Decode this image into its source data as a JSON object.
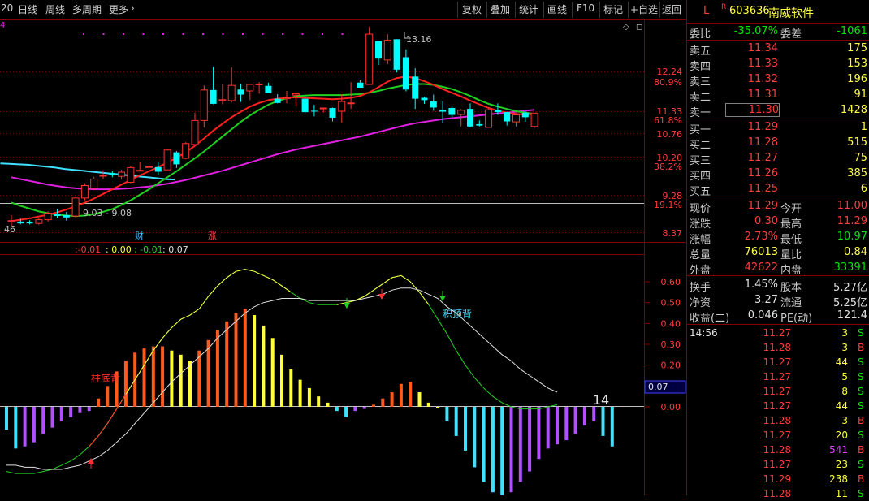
{
  "toolbar": {
    "period_num": "20",
    "daily": "日线",
    "weekly": "周线",
    "multi": "多周期",
    "more": "更多",
    "more_arrow": "›",
    "right_buttons": [
      "复权",
      "叠加",
      "统计",
      "画线",
      "F10",
      "标记",
      "+自选",
      "返回"
    ]
  },
  "stock": {
    "flag": "L",
    "flag2": "R",
    "code": "603636",
    "name": "南威软件"
  },
  "quote": {
    "weibi_label": "委比",
    "weibi": "-35.07%",
    "weicha_label": "委差",
    "weicha": "-1061",
    "sells": [
      {
        "label": "卖五",
        "price": "11.34",
        "vol": "175"
      },
      {
        "label": "卖四",
        "price": "11.33",
        "vol": "153"
      },
      {
        "label": "卖三",
        "price": "11.32",
        "vol": "196"
      },
      {
        "label": "卖二",
        "price": "11.31",
        "vol": "91"
      },
      {
        "label": "卖一",
        "price": "11.30",
        "vol": "1428"
      }
    ],
    "buys": [
      {
        "label": "买一",
        "price": "11.29",
        "vol": "1"
      },
      {
        "label": "买二",
        "price": "11.28",
        "vol": "515"
      },
      {
        "label": "买三",
        "price": "11.27",
        "vol": "75"
      },
      {
        "label": "买四",
        "price": "11.26",
        "vol": "385"
      },
      {
        "label": "买五",
        "price": "11.25",
        "vol": "6"
      }
    ],
    "stats": [
      {
        "l1": "现价",
        "v1": "11.29",
        "c1": "red",
        "l2": "今开",
        "v2": "11.00",
        "c2": "red"
      },
      {
        "l1": "涨跌",
        "v1": "0.30",
        "c1": "red",
        "l2": "最高",
        "v2": "11.29",
        "c2": "red"
      },
      {
        "l1": "涨幅",
        "v1": "2.73%",
        "c1": "red",
        "l2": "最低",
        "v2": "10.97",
        "c2": "green"
      },
      {
        "l1": "总量",
        "v1": "76013",
        "c1": "yellow",
        "l2": "量比",
        "v2": "0.84",
        "c2": "yellow"
      },
      {
        "l1": "外盘",
        "v1": "42622",
        "c1": "red",
        "l2": "内盘",
        "v2": "33391",
        "c2": "green"
      }
    ],
    "stats2": [
      {
        "l1": "换手",
        "v1": "1.45%",
        "l2": "股本",
        "v2": "5.27亿"
      },
      {
        "l1": "净资",
        "v1": "3.27",
        "l2": "流通",
        "v2": "5.25亿"
      },
      {
        "l1": "收益(二)",
        "v1": "0.046",
        "l2": "PE(动)",
        "v2": "121.4"
      }
    ]
  },
  "ticks": [
    {
      "time": "14:56",
      "price": "11.27",
      "vol": "3",
      "side": "S"
    },
    {
      "time": "",
      "price": "11.28",
      "vol": "3",
      "side": "B"
    },
    {
      "time": "",
      "price": "11.27",
      "vol": "44",
      "side": "S"
    },
    {
      "time": "",
      "price": "11.27",
      "vol": "5",
      "side": "S"
    },
    {
      "time": "",
      "price": "11.27",
      "vol": "8",
      "side": "S"
    },
    {
      "time": "",
      "price": "11.27",
      "vol": "44",
      "side": "S"
    },
    {
      "time": "",
      "price": "11.28",
      "vol": "3",
      "side": "B"
    },
    {
      "time": "",
      "price": "11.27",
      "vol": "20",
      "side": "S"
    },
    {
      "time": "",
      "price": "11.28",
      "vol": "541",
      "side": "B"
    },
    {
      "time": "",
      "price": "11.27",
      "vol": "23",
      "side": "S"
    },
    {
      "time": "",
      "price": "11.29",
      "vol": "238",
      "side": "B"
    },
    {
      "time": "",
      "price": "11.28",
      "vol": "11",
      "side": "S"
    }
  ],
  "colors": {
    "up": "#ff3232",
    "down": "#00ffff",
    "ma_red": "#ff2020",
    "ma_green": "#20d020",
    "ma_purple": "#e020e0",
    "ma_cyan": "#40e0ff",
    "grid": "#800000"
  },
  "chart_data": [
    {
      "type": "candlestick",
      "price_ticks": [
        "12.24",
        "11.33",
        "10.76",
        "10.20",
        "9.28",
        "8.37"
      ],
      "pct_ticks": [
        "80.9%",
        "61.8%",
        "38.2%",
        "19.1%"
      ],
      "high_label": "13.16",
      "low_label": "9.03 - 9.08",
      "left_label": "46",
      "top_left_label": "4",
      "markers": [
        "财",
        "涨"
      ],
      "candles": [
        {
          "o": 8.94,
          "h": 9.08,
          "l": 8.85,
          "c": 8.96
        },
        {
          "o": 8.94,
          "h": 9.0,
          "l": 8.88,
          "c": 8.9
        },
        {
          "o": 8.93,
          "h": 8.97,
          "l": 8.88,
          "c": 8.9
        },
        {
          "o": 8.9,
          "h": 9.01,
          "l": 8.87,
          "c": 8.98
        },
        {
          "o": 8.98,
          "h": 9.16,
          "l": 8.94,
          "c": 9.12
        },
        {
          "o": 9.11,
          "h": 9.21,
          "l": 9.02,
          "c": 9.06
        },
        {
          "o": 9.08,
          "h": 9.15,
          "l": 8.96,
          "c": 9.03
        },
        {
          "o": 9.06,
          "h": 9.48,
          "l": 9.03,
          "c": 9.45
        },
        {
          "o": 9.45,
          "h": 9.77,
          "l": 9.4,
          "c": 9.72
        },
        {
          "o": 9.66,
          "h": 9.91,
          "l": 9.62,
          "c": 9.86
        },
        {
          "o": 9.94,
          "h": 10.05,
          "l": 9.86,
          "c": 9.94
        },
        {
          "o": 9.99,
          "h": 10.03,
          "l": 9.9,
          "c": 9.95
        },
        {
          "o": 9.92,
          "h": 10.06,
          "l": 9.85,
          "c": 10.01
        },
        {
          "o": 9.79,
          "h": 10.14,
          "l": 9.77,
          "c": 10.11
        },
        {
          "o": 10.05,
          "h": 10.22,
          "l": 10.03,
          "c": 10.05
        },
        {
          "o": 10.13,
          "h": 10.21,
          "l": 10.06,
          "c": 10.13
        },
        {
          "o": 10.12,
          "h": 10.23,
          "l": 9.95,
          "c": 10.02
        },
        {
          "o": 10.06,
          "h": 10.5,
          "l": 10.06,
          "c": 10.49
        },
        {
          "o": 10.44,
          "h": 10.47,
          "l": 10.1,
          "c": 10.18
        },
        {
          "o": 10.31,
          "h": 10.66,
          "l": 10.29,
          "c": 10.63
        },
        {
          "o": 10.61,
          "h": 11.3,
          "l": 10.61,
          "c": 11.13
        },
        {
          "o": 11.13,
          "h": 11.89,
          "l": 10.98,
          "c": 11.79
        },
        {
          "o": 11.79,
          "h": 12.29,
          "l": 11.48,
          "c": 11.49
        },
        {
          "o": 11.56,
          "h": 11.91,
          "l": 11.48,
          "c": 11.58
        },
        {
          "o": 11.56,
          "h": 12.28,
          "l": 11.52,
          "c": 11.89
        },
        {
          "o": 11.8,
          "h": 11.92,
          "l": 11.53,
          "c": 11.69
        },
        {
          "o": 11.77,
          "h": 11.92,
          "l": 11.57,
          "c": 11.91
        },
        {
          "o": 11.92,
          "h": 11.96,
          "l": 11.71,
          "c": 11.92
        },
        {
          "o": 11.88,
          "h": 11.95,
          "l": 11.81,
          "c": 11.72
        },
        {
          "o": 11.6,
          "h": 11.7,
          "l": 11.5,
          "c": 11.51
        },
        {
          "o": 11.6,
          "h": 11.77,
          "l": 11.5,
          "c": 11.62
        },
        {
          "o": 11.68,
          "h": 11.69,
          "l": 11.44,
          "c": 11.71
        },
        {
          "o": 11.6,
          "h": 11.67,
          "l": 11.28,
          "c": 11.31
        },
        {
          "o": 11.34,
          "h": 11.47,
          "l": 11.22,
          "c": 11.33
        },
        {
          "o": 11.4,
          "h": 11.41,
          "l": 11.3,
          "c": 11.4
        },
        {
          "o": 11.4,
          "h": 11.41,
          "l": 11.11,
          "c": 11.19
        },
        {
          "o": 11.33,
          "h": 11.7,
          "l": 11.08,
          "c": 11.54
        },
        {
          "o": 11.51,
          "h": 11.96,
          "l": 11.38,
          "c": 11.51
        },
        {
          "o": 11.95,
          "h": 12.0,
          "l": 11.86,
          "c": 11.84
        },
        {
          "o": 11.91,
          "h": 13.16,
          "l": 11.91,
          "c": 13.0
        },
        {
          "o": 12.85,
          "h": 12.85,
          "l": 12.33,
          "c": 12.47
        },
        {
          "o": 12.44,
          "h": 13.0,
          "l": 12.35,
          "c": 12.87
        },
        {
          "o": 12.89,
          "h": 12.89,
          "l": 12.17,
          "c": 12.23
        },
        {
          "o": 12.5,
          "h": 12.67,
          "l": 11.76,
          "c": 11.8
        },
        {
          "o": 12.08,
          "h": 12.26,
          "l": 11.38,
          "c": 11.6
        },
        {
          "o": 11.62,
          "h": 11.64,
          "l": 11.49,
          "c": 11.57
        },
        {
          "o": 11.54,
          "h": 11.69,
          "l": 11.34,
          "c": 11.41
        },
        {
          "o": 11.36,
          "h": 11.55,
          "l": 11.07,
          "c": 11.32
        },
        {
          "o": 11.4,
          "h": 11.45,
          "l": 11.2,
          "c": 11.25
        },
        {
          "o": 11.26,
          "h": 11.38,
          "l": 11.0,
          "c": 11.35
        },
        {
          "o": 11.38,
          "h": 11.5,
          "l": 10.98,
          "c": 11.0
        },
        {
          "o": 11.05,
          "h": 11.13,
          "l": 11.0,
          "c": 11.02
        },
        {
          "o": 10.98,
          "h": 11.39,
          "l": 10.98,
          "c": 11.36
        },
        {
          "o": 11.35,
          "h": 11.5,
          "l": 11.25,
          "c": 11.31
        },
        {
          "o": 11.31,
          "h": 11.31,
          "l": 11.02,
          "c": 11.11
        },
        {
          "o": 11.1,
          "h": 11.29,
          "l": 11.0,
          "c": 11.25
        },
        {
          "o": 11.3,
          "h": 11.33,
          "l": 11.1,
          "c": 11.2
        },
        {
          "o": 11.0,
          "h": 11.29,
          "l": 10.97,
          "c": 11.29
        }
      ],
      "ma_red": [
        8.95,
        8.98,
        9.01,
        9.05,
        9.09,
        9.14,
        9.2,
        9.27,
        9.35,
        9.44,
        9.54,
        9.64,
        9.74,
        9.84,
        9.94,
        10.03,
        10.12,
        10.22,
        10.32,
        10.44,
        10.58,
        10.74,
        10.91,
        11.06,
        11.2,
        11.32,
        11.43,
        11.51,
        11.57,
        11.6,
        11.62,
        11.63,
        11.62,
        11.61,
        11.6,
        11.59,
        11.6,
        11.62,
        11.66,
        11.74,
        11.85,
        11.97,
        12.05,
        12.08,
        12.05,
        11.98,
        11.9,
        11.81,
        11.73,
        11.65,
        11.56,
        11.48,
        11.4,
        11.34,
        11.3,
        11.27,
        11.26,
        11.27
      ],
      "ma_green": [
        9.35,
        9.28,
        9.22,
        9.16,
        9.12,
        9.09,
        9.07,
        9.06,
        9.07,
        9.1,
        9.15,
        9.21,
        9.3,
        9.4,
        9.52,
        9.64,
        9.77,
        9.9,
        10.03,
        10.17,
        10.31,
        10.46,
        10.62,
        10.78,
        10.94,
        11.1,
        11.24,
        11.36,
        11.47,
        11.55,
        11.61,
        11.65,
        11.67,
        11.68,
        11.68,
        11.68,
        11.68,
        11.69,
        11.7,
        11.73,
        11.77,
        11.82,
        11.86,
        11.9,
        11.92,
        11.92,
        11.9,
        11.86,
        11.81,
        11.74,
        11.66,
        11.57,
        11.49,
        11.43,
        11.38,
        11.33,
        11.3,
        11.27
      ],
      "ma_purple": [
        9.9,
        9.86,
        9.82,
        9.78,
        9.74,
        9.71,
        9.68,
        9.66,
        9.65,
        9.64,
        9.64,
        9.64,
        9.65,
        9.66,
        9.68,
        9.7,
        9.73,
        9.76,
        9.8,
        9.84,
        9.89,
        9.94,
        9.99,
        10.04,
        10.1,
        10.16,
        10.22,
        10.28,
        10.34,
        10.4,
        10.45,
        10.5,
        10.54,
        10.58,
        10.62,
        10.66,
        10.7,
        10.74,
        10.78,
        10.83,
        10.88,
        10.93,
        10.98,
        11.03,
        11.07,
        11.1,
        11.13,
        11.16,
        11.18,
        11.2,
        11.22,
        11.24,
        11.26,
        11.28,
        11.3,
        11.32,
        11.34,
        11.36
      ],
      "ma_cyan": [
        10.2,
        10.19,
        10.18,
        10.17,
        10.15,
        10.13,
        10.11,
        10.08,
        10.06,
        10.04,
        10.02,
        10.0,
        9.98,
        9.96,
        9.94,
        9.92,
        9.9,
        9.88,
        9.86,
        9.85
      ]
    },
    {
      "type": "macd",
      "header": {
        "v1": "-0.01",
        "v2": "0.00",
        "v3": "-0.01",
        "v4": "0.07"
      },
      "yticks": [
        "0.60",
        "0.50",
        "0.40",
        "0.30",
        "0.20",
        "0.10",
        "0.00"
      ],
      "current_label": "0.07",
      "count_label": "14",
      "annotations": [
        "柱底背",
        "积顶背"
      ],
      "bars": [
        -0.11,
        -0.2,
        -0.19,
        -0.17,
        -0.13,
        -0.1,
        -0.07,
        -0.05,
        -0.03,
        -0.02,
        0.04,
        0.1,
        0.17,
        0.22,
        0.26,
        0.28,
        0.29,
        0.29,
        0.27,
        0.25,
        0.22,
        0.27,
        0.32,
        0.37,
        0.41,
        0.45,
        0.47,
        0.44,
        0.39,
        0.33,
        0.25,
        0.18,
        0.13,
        0.09,
        0.05,
        0.02,
        -0.02,
        -0.05,
        -0.02,
        -0.01,
        0.01,
        0.04,
        0.07,
        0.11,
        0.12,
        0.07,
        0.02,
        0.0,
        -0.07,
        -0.14,
        -0.21,
        -0.29,
        -0.36,
        -0.41,
        -0.43,
        -0.41,
        -0.36,
        -0.31,
        -0.25,
        -0.2,
        -0.18,
        -0.16,
        -0.13,
        -0.09,
        -0.07,
        -0.14,
        -0.19
      ],
      "dif": [
        -0.31,
        -0.32,
        -0.32,
        -0.32,
        -0.31,
        -0.3,
        -0.28,
        -0.26,
        -0.23,
        -0.19,
        -0.14,
        -0.08,
        -0.01,
        0.06,
        0.13,
        0.2,
        0.27,
        0.33,
        0.38,
        0.42,
        0.44,
        0.47,
        0.53,
        0.58,
        0.62,
        0.65,
        0.66,
        0.65,
        0.63,
        0.61,
        0.58,
        0.55,
        0.52,
        0.5,
        0.49,
        0.49,
        0.49,
        0.5,
        0.51,
        0.53,
        0.56,
        0.59,
        0.62,
        0.63,
        0.6,
        0.55,
        0.49,
        0.42,
        0.35,
        0.27,
        0.2,
        0.14,
        0.09,
        0.05,
        0.02,
        0.0,
        -0.01,
        -0.01,
        -0.01,
        0.0,
        0.01
      ],
      "dea": [
        -0.28,
        -0.28,
        -0.29,
        -0.29,
        -0.3,
        -0.3,
        -0.3,
        -0.29,
        -0.28,
        -0.26,
        -0.24,
        -0.21,
        -0.17,
        -0.13,
        -0.08,
        -0.03,
        0.02,
        0.07,
        0.12,
        0.16,
        0.2,
        0.24,
        0.28,
        0.33,
        0.37,
        0.41,
        0.45,
        0.48,
        0.5,
        0.51,
        0.52,
        0.52,
        0.52,
        0.51,
        0.51,
        0.51,
        0.51,
        0.51,
        0.51,
        0.52,
        0.53,
        0.54,
        0.56,
        0.57,
        0.57,
        0.56,
        0.54,
        0.52,
        0.48,
        0.45,
        0.41,
        0.37,
        0.33,
        0.29,
        0.25,
        0.22,
        0.18,
        0.15,
        0.12,
        0.09,
        0.07
      ]
    }
  ]
}
